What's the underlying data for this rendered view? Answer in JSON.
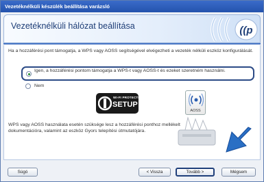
{
  "window": {
    "title": "Vezetéknélküli készülék beállítása varázsló"
  },
  "header": {
    "title": "Vezetéknélküli hálózat beállítása"
  },
  "content": {
    "description": "Ha a hozzáférési pont támogatja, a WPS vagy AOSS segítségével elvégezheti a vezeték nélküli eszköz konfigurálását.",
    "options": [
      {
        "label": "Igen, a hozzáférési pontom támogatja a WPS-t vagy AOSS-t és ezeket szeretném használni.",
        "selected": true
      },
      {
        "label": "Nem",
        "selected": false
      }
    ],
    "wps_logo": {
      "small": "WI-FI PROTECTED",
      "big": "SETUP"
    },
    "aoss_logo": "AOSS",
    "note": "WPS vagy AOSS használata esetén szüksége lesz a hozzáférési ponthoz mellékelt dokumentációra, valamint az eszköz Gyors telepítési útmutatójára."
  },
  "buttons": {
    "help": "Súgó",
    "back": "< Vissza",
    "next": "Tovább >",
    "cancel": "Mégsem"
  },
  "colors": {
    "accent": "#2453ad",
    "arrow": "#2a6fc4",
    "selected_radio": "#1f8a2a"
  }
}
